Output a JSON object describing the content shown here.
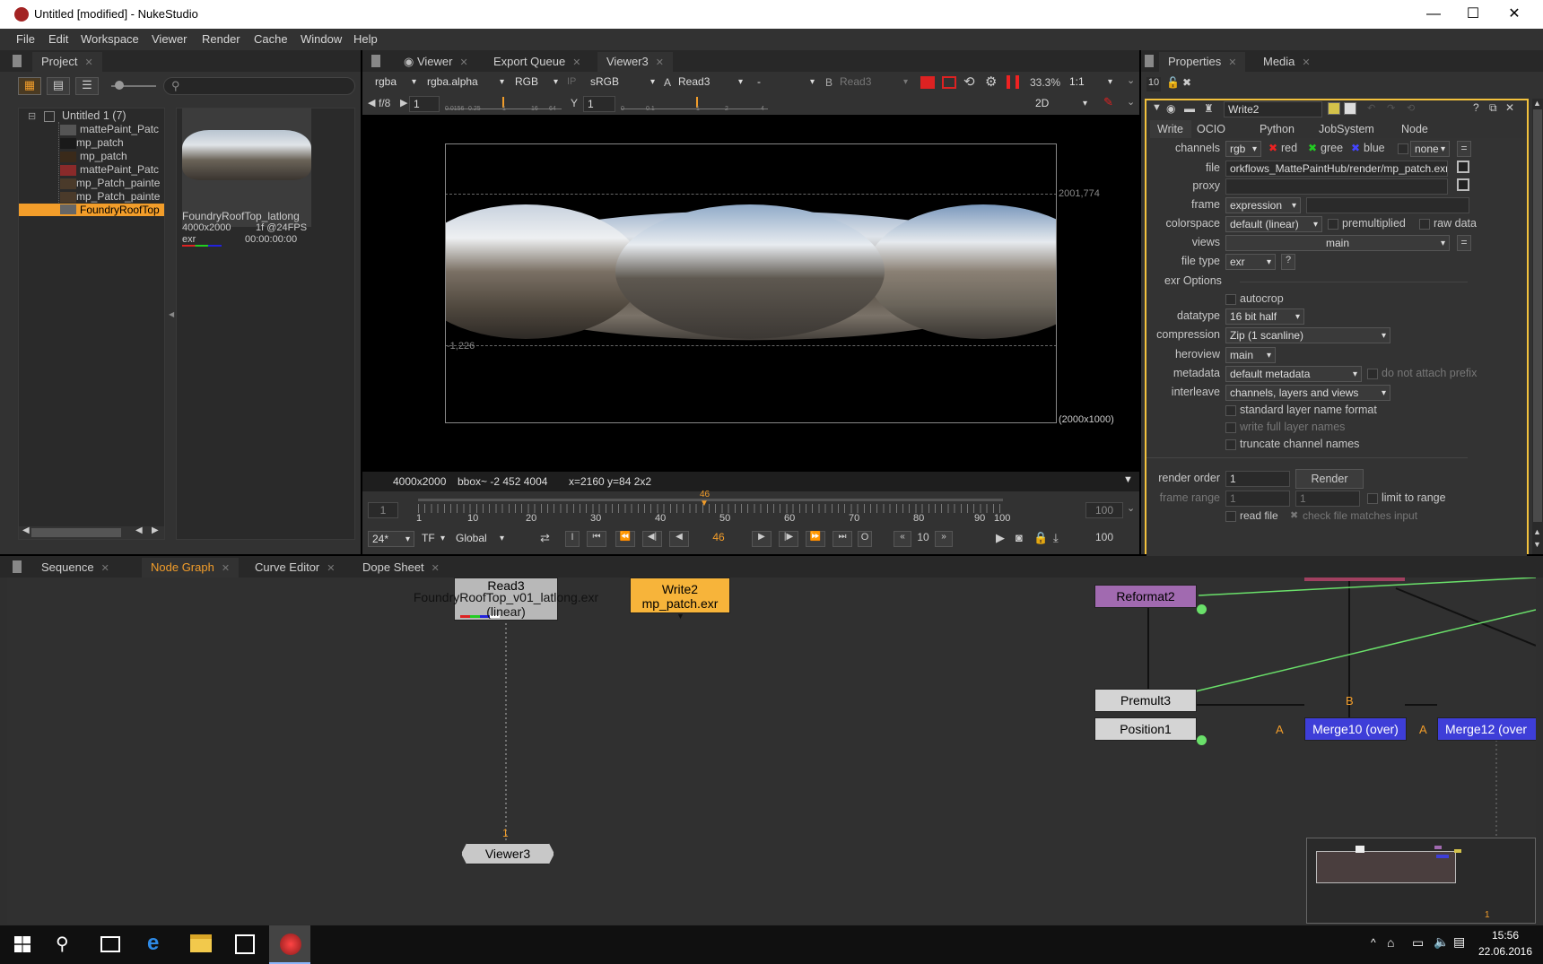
{
  "window": {
    "title": "Untitled [modified] - NukeStudio",
    "minimize": "—",
    "maximize": "☐",
    "close": "✕"
  },
  "menu": [
    "File",
    "Edit",
    "Workspace",
    "Viewer",
    "Render",
    "Cache",
    "Window",
    "Help"
  ],
  "project": {
    "tab": "Project",
    "root": "Untitled 1 (7)",
    "items": [
      "mattePaint_Patc",
      "mp_patch",
      "mp_patch",
      "mattePaint_Patc",
      "mp_Patch_painte",
      "mp_Patch_painte",
      "FoundryRoofTop"
    ],
    "thumb": {
      "name": "FoundryRoofTop_latlong",
      "res": "4000x2000",
      "fps": "1f @24FPS",
      "ext": "exr",
      "tc": "00:00:00:00"
    }
  },
  "viewer": {
    "tabs": [
      "Viewer",
      "Export Queue",
      "Viewer3"
    ],
    "toolbar": {
      "channels": "rgba",
      "alpha": "rgba.alpha",
      "display": "RGB",
      "ip": "IP",
      "lut": "sRGB",
      "a_label": "A",
      "a_input": "Read3",
      "dash": "-",
      "b_label": "B",
      "b_input": "Read3",
      "zoom": "33.3%",
      "ratio": "1:1"
    },
    "toolbar2": {
      "fstop": "f/8",
      "gain": "1",
      "y_label": "Y",
      "gamma": "1",
      "view": "2D"
    },
    "gain_ticks": [
      "0.0156",
      "0.25",
      "1",
      "16",
      "64"
    ],
    "gamma_ticks": [
      "0",
      "0.1",
      "1",
      "2",
      "4"
    ],
    "bbox_top": "2001,774",
    "bbox_bot": "-1,226",
    "format": "(2000x1000)",
    "info": {
      "res": "4000x2000",
      "bbox": "bbox~ -2 452 4004",
      "coords": "x=2160 y=84 2x2"
    },
    "timeline": {
      "start": "1",
      "end": "100",
      "current": "46",
      "ticks": [
        "1",
        "10",
        "20",
        "30",
        "40",
        "50",
        "60",
        "70",
        "80",
        "90",
        "100"
      ]
    },
    "transport": {
      "fps": "24*",
      "tf": "TF",
      "range": "Global",
      "frame": "46",
      "step": "10",
      "end": "100",
      "i": "I",
      "o": "O"
    }
  },
  "properties": {
    "tabs": [
      "Properties",
      "Media"
    ],
    "max_panels": "10",
    "node_name": "Write2",
    "subtabs": [
      "Write",
      "OCIO",
      "Python",
      "JobSystem",
      "Node"
    ],
    "channels": {
      "label": "channels",
      "value": "rgb",
      "red": "red",
      "green": "gree",
      "blue": "blue",
      "none": "none",
      "eq": "="
    },
    "file": {
      "label": "file",
      "value": "orkflows_MattePaintHub/render/mp_patch.exr"
    },
    "proxy": {
      "label": "proxy",
      "value": ""
    },
    "frame": {
      "label": "frame",
      "value": "expression"
    },
    "colorspace": {
      "label": "colorspace",
      "value": "default (linear)",
      "premult": "premultiplied",
      "raw": "raw data"
    },
    "views": {
      "label": "views",
      "value": "main"
    },
    "file_type": {
      "label": "file type",
      "value": "exr",
      "help": "?"
    },
    "exr_options": "exr Options",
    "autocrop": "autocrop",
    "datatype": {
      "label": "datatype",
      "value": "16 bit half"
    },
    "compression": {
      "label": "compression",
      "value": "Zip (1 scanline)"
    },
    "heroview": {
      "label": "heroview",
      "value": "main"
    },
    "metadata": {
      "label": "metadata",
      "value": "default metadata",
      "attach": "do not attach prefix"
    },
    "interleave": {
      "label": "interleave",
      "value": "channels, layers and views"
    },
    "std_layer": "standard layer name format",
    "write_full": "write full layer names",
    "truncate": "truncate channel names",
    "render_order": {
      "label": "render order",
      "value": "1",
      "button": "Render"
    },
    "frame_range": {
      "label": "frame range",
      "from": "1",
      "to": "1",
      "limit": "limit to range"
    },
    "read_file": "read file",
    "check_file": "check file matches input"
  },
  "bottom_tabs": [
    "Sequence",
    "Node Graph",
    "Curve Editor",
    "Dope Sheet"
  ],
  "nodes": {
    "read3": {
      "name": "Read3",
      "file": "FoundryRoofTop_v01_latlong.exr",
      "cs": "(linear)"
    },
    "write2": {
      "name": "Write2",
      "file": "mp_patch.exr"
    },
    "reformat2": "Reformat2",
    "premult3": "Premult3",
    "position1": "Position1",
    "merge10": "Merge10 (over)",
    "merge12": "Merge12 (over",
    "viewer3": "Viewer3",
    "input_a": "A",
    "input_a2": "A",
    "input_b": "B",
    "pipe1": "1",
    "pipe2": "1"
  },
  "taskbar": {
    "time": "15:56",
    "date": "22.06.2016"
  },
  "colors": {
    "accent": "#f29d2a",
    "read_node": "#b8b8b8",
    "write_node": "#f7b43a",
    "reformat_node": "#a16ab0",
    "merge_node": "#3e3ed8",
    "panel": "#323232"
  }
}
